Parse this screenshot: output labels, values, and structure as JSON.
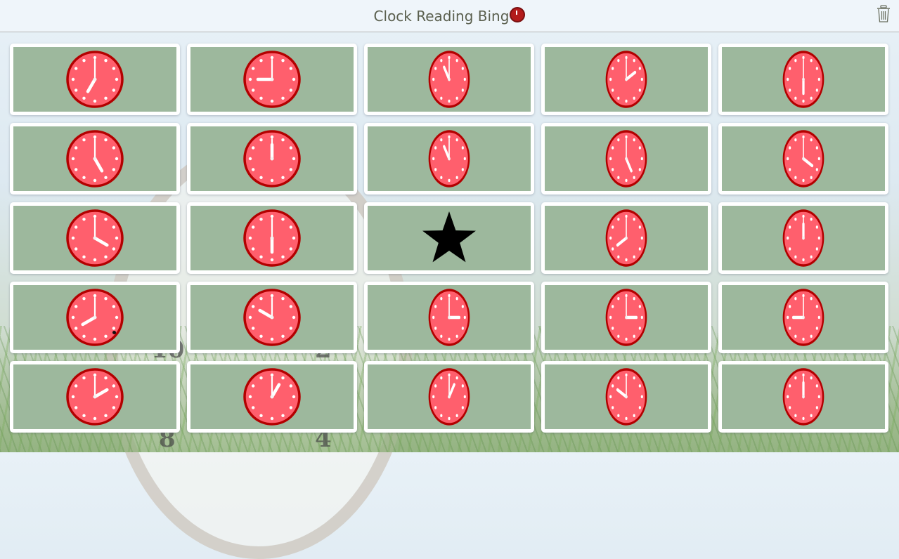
{
  "header": {
    "title": "Clock Reading Bing",
    "title_icon": "alarm-clock-icon",
    "trash_icon": "trash-icon"
  },
  "colors": {
    "card_bg": "#9db89d",
    "card_border": "#ffffff",
    "clock_face": "#ff5f6d",
    "clock_rim": "#b30000",
    "hands": "#ffffff",
    "title_text": "#5a5f4e"
  },
  "background": {
    "numerals": [
      "10",
      "2",
      "8",
      "4"
    ]
  },
  "board": {
    "rows": 5,
    "cols": 5,
    "cells": [
      {
        "type": "clock",
        "hour": 7,
        "minute": 0,
        "label": "7:00"
      },
      {
        "type": "clock",
        "hour": 9,
        "minute": 0,
        "label": "9:00"
      },
      {
        "type": "clock",
        "hour": 11,
        "minute": 0,
        "label": "11:00"
      },
      {
        "type": "clock",
        "hour": 2,
        "minute": 0,
        "label": "2:00"
      },
      {
        "type": "clock",
        "hour": 6,
        "minute": 0,
        "label": "6:00"
      },
      {
        "type": "clock",
        "hour": 5,
        "minute": 0,
        "label": "5:00"
      },
      {
        "type": "clock",
        "hour": 12,
        "minute": 0,
        "label": "12:00"
      },
      {
        "type": "clock",
        "hour": 11,
        "minute": 0,
        "label": "11:00"
      },
      {
        "type": "clock",
        "hour": 5,
        "minute": 0,
        "label": "5:00"
      },
      {
        "type": "clock",
        "hour": 4,
        "minute": 0,
        "label": "4:00"
      },
      {
        "type": "clock",
        "hour": 4,
        "minute": 0,
        "label": "4:00"
      },
      {
        "type": "clock",
        "hour": 6,
        "minute": 0,
        "label": "6:00"
      },
      {
        "type": "free",
        "icon": "star-icon",
        "label": "Free space"
      },
      {
        "type": "clock",
        "hour": 8,
        "minute": 0,
        "label": "8:00"
      },
      {
        "type": "clock",
        "hour": 12,
        "minute": 0,
        "label": "12:00"
      },
      {
        "type": "clock",
        "hour": 8,
        "minute": 0,
        "label": "8:00",
        "marked": true
      },
      {
        "type": "clock",
        "hour": 10,
        "minute": 0,
        "label": "10:00"
      },
      {
        "type": "clock",
        "hour": 3,
        "minute": 0,
        "label": "3:00"
      },
      {
        "type": "clock",
        "hour": 3,
        "minute": 0,
        "label": "3:00"
      },
      {
        "type": "clock",
        "hour": 9,
        "minute": 0,
        "label": "9:00"
      },
      {
        "type": "clock",
        "hour": 2,
        "minute": 0,
        "label": "2:00"
      },
      {
        "type": "clock",
        "hour": 1,
        "minute": 0,
        "label": "1:00"
      },
      {
        "type": "clock",
        "hour": 1,
        "minute": 0,
        "label": "1:00"
      },
      {
        "type": "clock",
        "hour": 10,
        "minute": 0,
        "label": "10:00"
      },
      {
        "type": "clock",
        "hour": 12,
        "minute": 0,
        "label": "12:00"
      }
    ]
  }
}
